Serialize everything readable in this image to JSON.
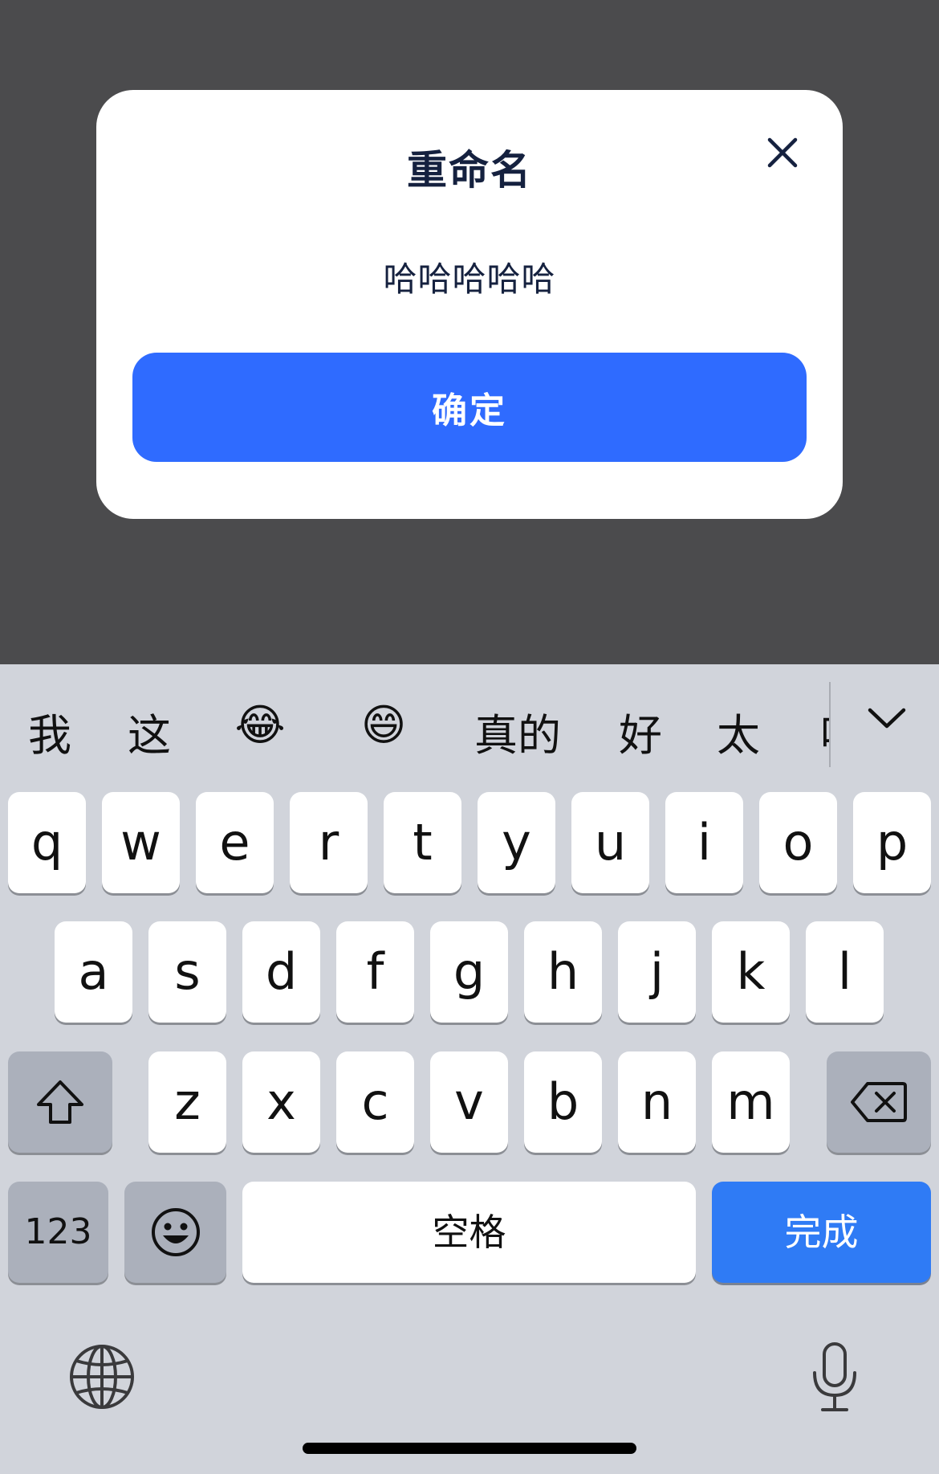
{
  "dialog": {
    "title": "重命名",
    "value": "哈哈哈哈哈",
    "confirm_label": "确定"
  },
  "suggestions": [
    "我",
    "这",
    "😂",
    "😄",
    "真的",
    "好",
    "太",
    "哈"
  ],
  "keyboard": {
    "row1": [
      "q",
      "w",
      "e",
      "r",
      "t",
      "y",
      "u",
      "i",
      "o",
      "p"
    ],
    "row2": [
      "a",
      "s",
      "d",
      "f",
      "g",
      "h",
      "j",
      "k",
      "l"
    ],
    "row3": [
      "z",
      "x",
      "c",
      "v",
      "b",
      "n",
      "m"
    ],
    "numbers_label": "123",
    "space_label": "空格",
    "done_label": "完成"
  },
  "colors": {
    "accent": "#2f6bff",
    "done_key": "#2f7bf5",
    "title_text": "#15213f",
    "backdrop": "#4b4b4d",
    "keyboard_bg": "#d1d4db"
  },
  "icons": {
    "close": "close-icon",
    "expand": "chevron-down-icon",
    "shift": "shift-icon",
    "delete": "backspace-icon",
    "emoji": "emoji-icon",
    "globe": "globe-icon",
    "mic": "microphone-icon"
  }
}
